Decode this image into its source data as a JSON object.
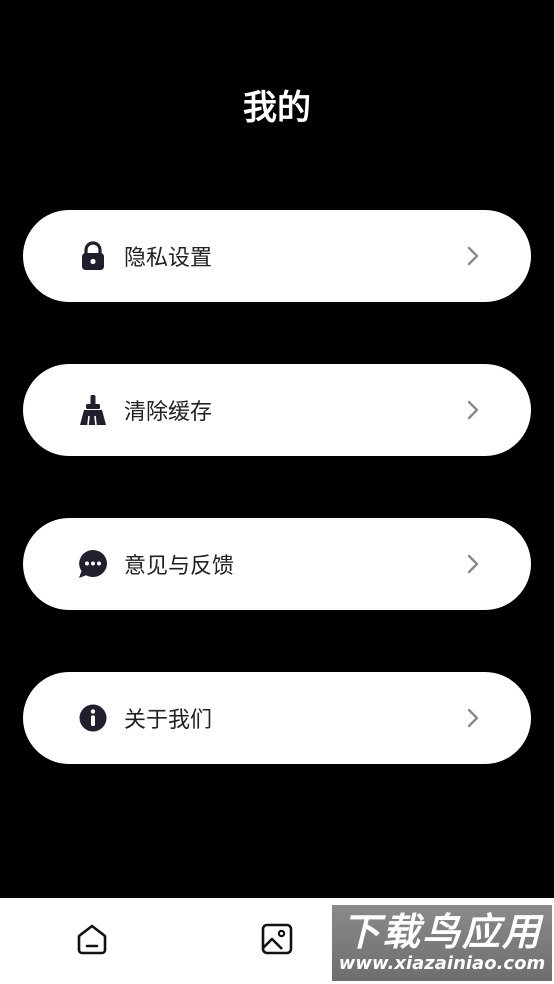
{
  "header": {
    "title": "我的"
  },
  "menu": {
    "items": [
      {
        "label": "隐私设置",
        "icon": "lock-icon"
      },
      {
        "label": "清除缓存",
        "icon": "broom-icon"
      },
      {
        "label": "意见与反馈",
        "icon": "chat-bubble-icon"
      },
      {
        "label": "关于我们",
        "icon": "info-icon"
      }
    ]
  },
  "bottom_nav": {
    "tabs": [
      {
        "icon": "home-icon"
      },
      {
        "icon": "image-icon"
      }
    ]
  },
  "watermark": {
    "main": "下载鸟应用",
    "url": "www.xiazainiao.com"
  },
  "colors": {
    "background": "#000000",
    "card": "#ffffff",
    "icon": "#1f1f2e",
    "chevron": "#8a8a8a"
  }
}
